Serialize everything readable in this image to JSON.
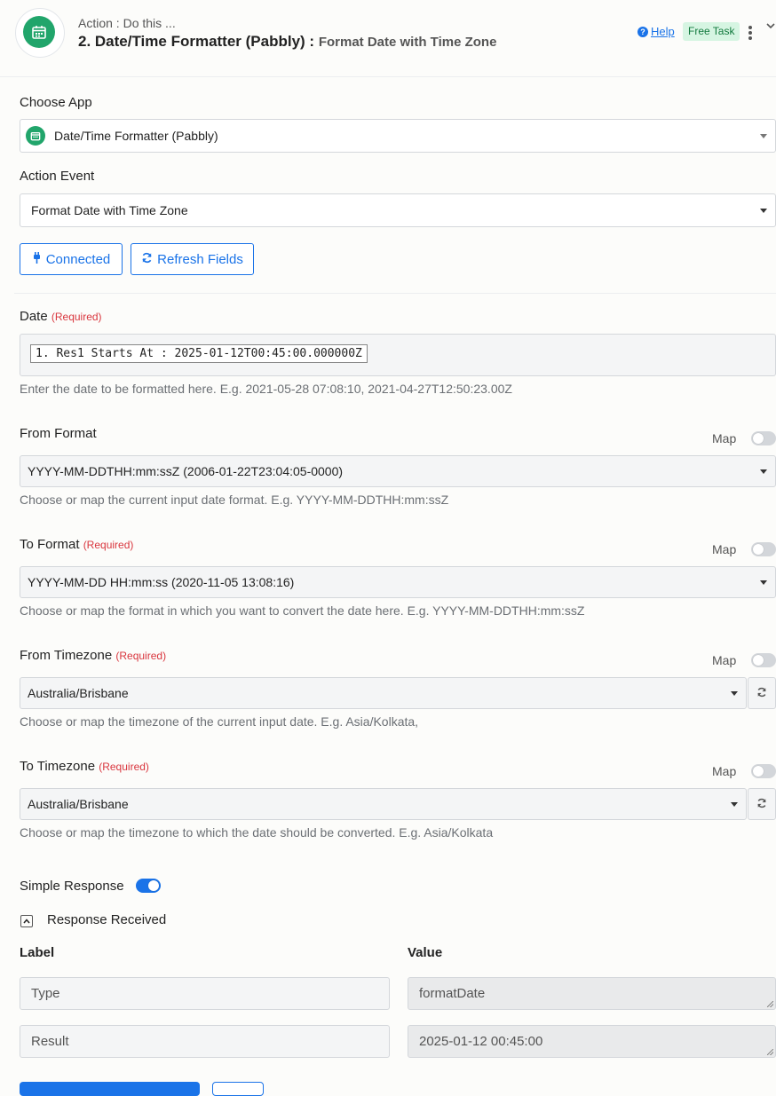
{
  "header": {
    "subtitle": "Action : Do this ...",
    "title": "2. Date/Time Formatter (Pabbly) :",
    "event": "Format Date with Time Zone",
    "help_label": "Help",
    "badge": "Free Task",
    "app_icon": "calendar-icon",
    "accent": "#21a56b"
  },
  "choose_app": {
    "label": "Choose App",
    "value": "Date/Time Formatter (Pabbly)"
  },
  "action_event": {
    "label": "Action Event",
    "value": "Format Date with Time Zone"
  },
  "buttons": {
    "connected": "Connected",
    "connected_icon": "plug-icon",
    "refresh": "Refresh Fields",
    "refresh_icon": "refresh-icon"
  },
  "date_field": {
    "label": "Date",
    "required": "(Required)",
    "pill": "1. Res1 Starts At : 2025-01-12T00:45:00.000000Z",
    "help": "Enter the date to be formatted here. E.g. 2021-05-28 07:08:10, 2021-04-27T12:50:23.00Z"
  },
  "from_format": {
    "label": "From Format",
    "map_label": "Map",
    "value": "YYYY-MM-DDTHH:mm:ssZ (2006-01-22T23:04:05-0000)",
    "help": "Choose or map the current input date format. E.g. YYYY-MM-DDTHH:mm:ssZ"
  },
  "to_format": {
    "label": "To Format",
    "required": "(Required)",
    "map_label": "Map",
    "value": "YYYY-MM-DD HH:mm:ss (2020-11-05 13:08:16)",
    "help": "Choose or map the format in which you want to convert the date here. E.g. YYYY-MM-DDTHH:mm:ssZ"
  },
  "from_timezone": {
    "label": "From Timezone",
    "required": "(Required)",
    "map_label": "Map",
    "value": "Australia/Brisbane",
    "help": "Choose or map the timezone of the current input date. E.g. Asia/Kolkata,"
  },
  "to_timezone": {
    "label": "To Timezone",
    "required": "(Required)",
    "map_label": "Map",
    "value": "Australia/Brisbane",
    "help": "Choose or map the timezone to which the date should be converted. E.g. Asia/Kolkata"
  },
  "simple_response": {
    "label": "Simple Response",
    "enabled": true
  },
  "response": {
    "title": "Response Received",
    "col_label": "Label",
    "col_value": "Value",
    "rows": [
      {
        "label": "Type",
        "value": "formatDate"
      },
      {
        "label": "Result",
        "value": "2025-01-12 00:45:00"
      }
    ]
  }
}
